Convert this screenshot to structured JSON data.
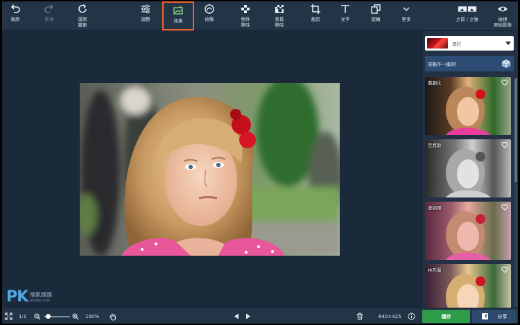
{
  "toolbar": {
    "undo": "復原",
    "redo": "重做",
    "revert": "還原\n變更",
    "adjust": "調整",
    "effects": "效果",
    "retouch": "修飾",
    "object_removal": "物件\n移除",
    "bg_removal": "背景\n移除",
    "crop": "裁剪",
    "text": "文字",
    "rotate": "旋轉",
    "more": "更多",
    "before_after": "之前 / 之後",
    "view_original": "檢視\n原始影像"
  },
  "side": {
    "dropdown_value": "流行",
    "banner_text": "來點不一樣的！",
    "effects": [
      {
        "name": "戲劇化"
      },
      {
        "name": "亞歷斯"
      },
      {
        "name": "波納爾"
      },
      {
        "name": "林布蘭"
      }
    ]
  },
  "bottom": {
    "fit": "1:1",
    "zoom": "100%",
    "dimensions": "640×425",
    "save": "儲存",
    "share": "分享"
  },
  "watermark": {
    "logo": "PK",
    "cn": "痞凱踏踏",
    "url": "pkstep.com"
  },
  "colors": {
    "accent_highlight": "#f0642d",
    "save_green": "#2d9b47",
    "share_blue": "#2c4a6e",
    "background": "#1b2a3b"
  }
}
